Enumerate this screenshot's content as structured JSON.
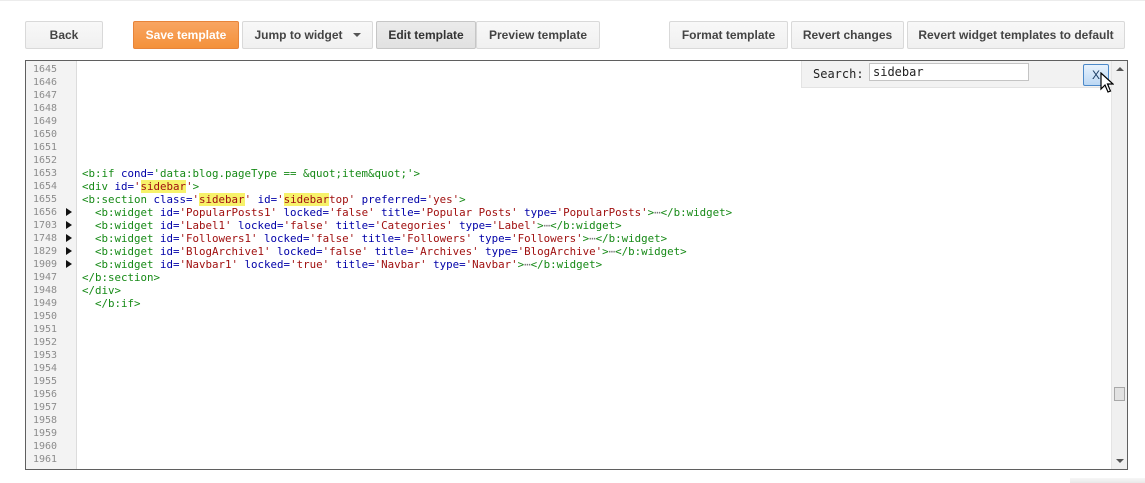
{
  "toolbar": {
    "back": "Back",
    "save_template": "Save template",
    "jump_to_widget": "Jump to widget",
    "edit_template": "Edit template",
    "preview_template": "Preview template",
    "format_template": "Format template",
    "revert_changes": "Revert changes",
    "revert_widget_templates": "Revert widget templates to default"
  },
  "search": {
    "label": "Search:",
    "value": "sidebar",
    "close_label": "X"
  },
  "gutter_lines": [
    "1645",
    "1646",
    "1647",
    "1648",
    "1649",
    "1650",
    "1651",
    "1652",
    "1653",
    "1654",
    "1655",
    "1656",
    "1703",
    "1748",
    "1829",
    "1909",
    "1947",
    "1948",
    "1949",
    "1950",
    "1951",
    "1952",
    "1953",
    "1954",
    "1955",
    "1956",
    "1957",
    "1958",
    "1959",
    "1960",
    "1961"
  ],
  "folded_lines": [
    "1656",
    "1703",
    "1748",
    "1829",
    "1909"
  ],
  "colors": {
    "accent_orange": "#f4913a",
    "highlight": "#f7f26a",
    "tag": "#178a17",
    "attribute": "#0000a8",
    "string": "#a01010"
  },
  "code": {
    "l1653": {
      "p1": "<b:if ",
      "a1": "cond=",
      "s1": "'data:blog.pageType == &quot;item&quot;'",
      "p2": ">"
    },
    "l1654": {
      "p1": "<div ",
      "a1": "id=",
      "q1": "'",
      "h1": "sidebar",
      "q2": "'",
      "p2": ">"
    },
    "l1655": {
      "p1": "<b:section ",
      "a1": "class=",
      "q1": "'",
      "h1": "sidebar",
      "q2": "' ",
      "a2": "id=",
      "q3": "'",
      "h2": "sidebar",
      "q4": "top' ",
      "a3": "preferred=",
      "s3": "'yes'",
      "p2": ">"
    },
    "l1656": {
      "p1": "  <b:widget ",
      "a1": "id=",
      "s1": "'PopularPosts1' ",
      "a2": "locked=",
      "s2": "'false' ",
      "a3": "title=",
      "s3": "'Popular Posts' ",
      "a4": "type=",
      "s4": "'PopularPosts'",
      "p2": ">",
      "e": "⋯",
      "p3": "</b:widget>"
    },
    "l1703": {
      "p1": "  <b:widget ",
      "a1": "id=",
      "s1": "'Label1' ",
      "a2": "locked=",
      "s2": "'false' ",
      "a3": "title=",
      "s3": "'Categories' ",
      "a4": "type=",
      "s4": "'Label'",
      "p2": ">",
      "e": "⋯",
      "p3": "</b:widget>"
    },
    "l1748": {
      "p1": "  <b:widget ",
      "a1": "id=",
      "s1": "'Followers1' ",
      "a2": "locked=",
      "s2": "'false' ",
      "a3": "title=",
      "s3": "'Followers' ",
      "a4": "type=",
      "s4": "'Followers'",
      "p2": ">",
      "e": "⋯",
      "p3": "</b:widget>"
    },
    "l1829": {
      "p1": "  <b:widget ",
      "a1": "id=",
      "s1": "'BlogArchive1' ",
      "a2": "locked=",
      "s2": "'false' ",
      "a3": "title=",
      "s3": "'Archives' ",
      "a4": "type=",
      "s4": "'BlogArchive'",
      "p2": ">",
      "e": "⋯",
      "p3": "</b:widget>"
    },
    "l1909": {
      "p1": "  <b:widget ",
      "a1": "id=",
      "s1": "'Navbar1' ",
      "a2": "locked=",
      "s2": "'true' ",
      "a3": "title=",
      "s3": "'Navbar' ",
      "a4": "type=",
      "s4": "'Navbar'",
      "p2": ">",
      "e": "⋯",
      "p3": "</b:widget>"
    },
    "l1947": {
      "p1": "</b:section>"
    },
    "l1948": {
      "p1": "</div>"
    },
    "l1949": {
      "p1": "  </b:if>"
    }
  }
}
